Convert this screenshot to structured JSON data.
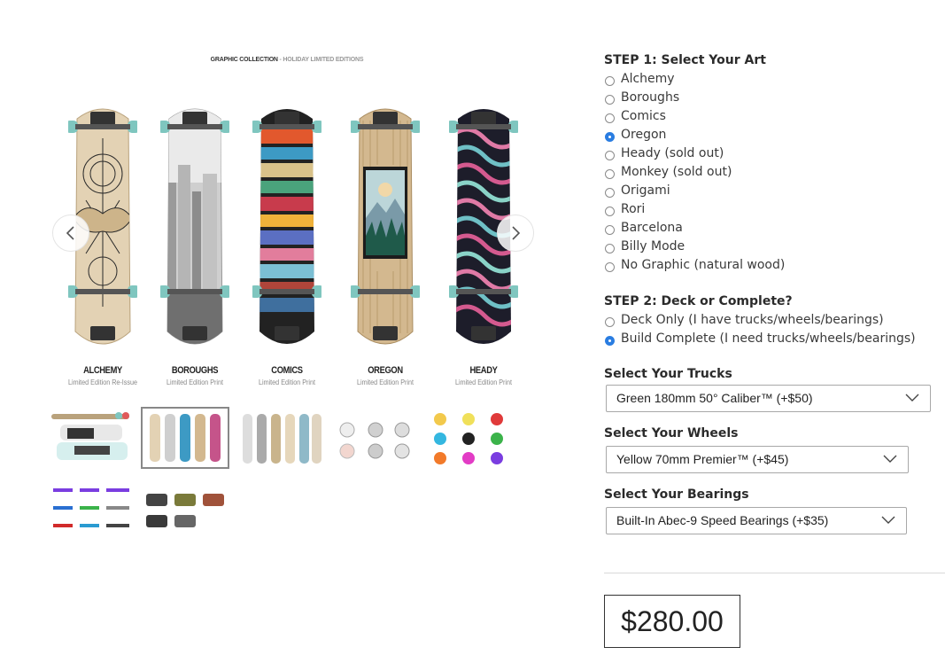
{
  "gallery": {
    "collection_title": "GRAPHIC COLLECTION",
    "collection_subtitle": "- HOLIDAY LIMITED EDITIONS",
    "boards": [
      {
        "name": "ALCHEMY",
        "sub": "Limited Edition Re-Issue"
      },
      {
        "name": "BOROUGHS",
        "sub": "Limited Edition Print"
      },
      {
        "name": "COMICS",
        "sub": "Limited Edition Print"
      },
      {
        "name": "OREGON",
        "sub": "Limited Edition Print"
      },
      {
        "name": "HEADY",
        "sub": "Limited Edition Print"
      }
    ],
    "active_thumbnail": 2,
    "thumbnail_count": 7
  },
  "step1": {
    "title": "STEP 1: Select Your Art",
    "options": [
      "Alchemy",
      "Boroughs",
      "Comics",
      "Oregon",
      "Heady (sold out)",
      "Monkey (sold out)",
      "Origami",
      "Rori",
      "Barcelona",
      "Billy Mode",
      "No Graphic (natural wood)"
    ],
    "selected": "Oregon"
  },
  "step2": {
    "title": "STEP 2: Deck or Complete?",
    "options": [
      "Deck Only (I have trucks/wheels/bearings)",
      "Build Complete (I need trucks/wheels/bearings)"
    ],
    "selected": "Build Complete (I need trucks/wheels/bearings)"
  },
  "trucks": {
    "label": "Select Your Trucks",
    "value": "Green 180mm 50° Caliber™ (+$50)"
  },
  "wheels": {
    "label": "Select Your Wheels",
    "value": "Yellow 70mm Premier™ (+$45)"
  },
  "bearings": {
    "label": "Select Your Bearings",
    "value": "Built-In Abec-9 Speed Bearings (+$35)"
  },
  "price": "$280.00",
  "colors": {
    "accent": "#2a7de1",
    "wheel": "#7fc6bf"
  }
}
